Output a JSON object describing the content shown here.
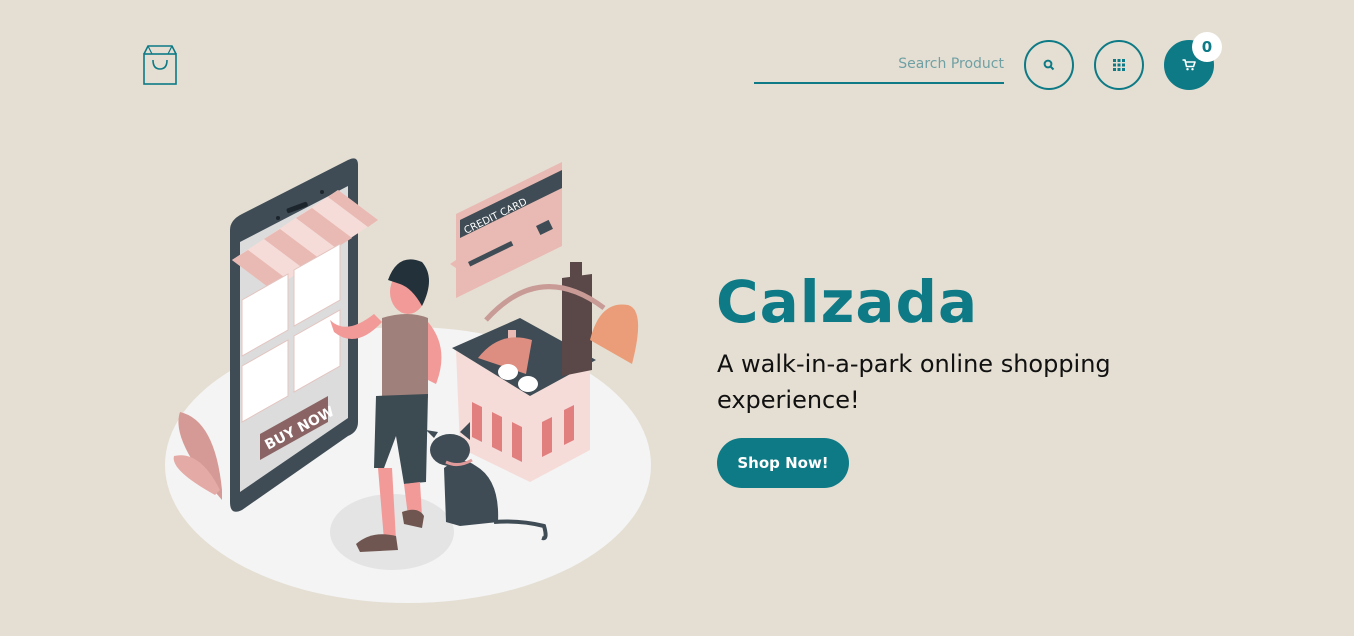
{
  "header": {
    "logo_icon": "shopping-bag-icon",
    "search": {
      "placeholder": "Search Product",
      "value": ""
    },
    "buttons": {
      "search_icon": "search-icon",
      "apps_icon": "grid-icon",
      "cart_icon": "cart-icon"
    },
    "cart_count": "0"
  },
  "hero": {
    "title": "Calzada",
    "subtitle": "A walk-in-a-park online shopping experience!",
    "cta_label": "Shop Now!"
  },
  "illustration": {
    "card_label": "CREDIT CARD",
    "sign_label": "BUY NOW"
  },
  "colors": {
    "background": "#e5dfd3",
    "accent": "#0d7a86",
    "pink": "#e9b9b3",
    "dark": "#3f4c55"
  }
}
